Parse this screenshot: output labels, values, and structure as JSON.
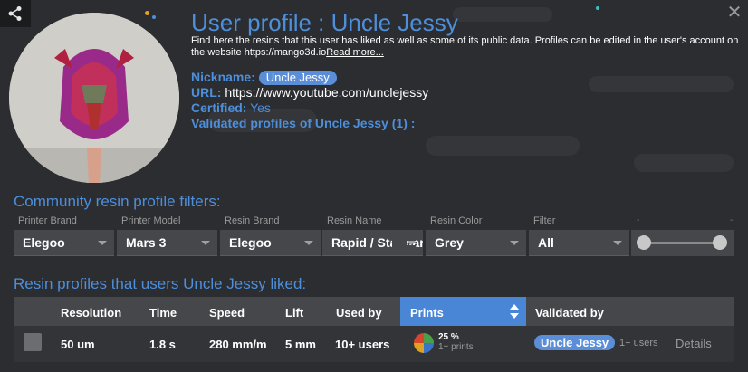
{
  "header": {
    "title": "User profile : Uncle Jessy",
    "description": "Find here the resins that this user has liked as well as some of its public data. Profiles can be edited in the user's account on the website https://mango3d.io",
    "read_more": "Read more...",
    "share_icon": "share-icon",
    "close_icon": "close-icon"
  },
  "profile": {
    "nickname_label": "Nickname:",
    "nickname": "Uncle Jessy",
    "url_label": "URL:",
    "url": "https://www.youtube.com/unclejessy",
    "certified_label": "Certified:",
    "certified": "Yes",
    "validated_profiles": "Validated profiles of Uncle Jessy (1) :"
  },
  "filters": {
    "title": "Community resin profile filters:",
    "items": [
      {
        "label": "Printer Brand",
        "value": "Elegoo"
      },
      {
        "label": "Printer Model",
        "value": "Mars 3"
      },
      {
        "label": "Resin Brand",
        "value": "Elegoo"
      },
      {
        "label": "Resin Name",
        "value": "Rapid / Standard"
      },
      {
        "label": "Resin Color",
        "value": "Grey"
      },
      {
        "label": "Filter",
        "value": "All"
      }
    ],
    "dash": "-"
  },
  "liked": {
    "title": "Resin profiles that users Uncle Jessy liked:",
    "columns": [
      "Resolution",
      "Time",
      "Speed",
      "Lift",
      "Used by",
      "Prints",
      "Validated by"
    ],
    "rows": [
      {
        "resolution": "50 um",
        "time": "1.8 s",
        "speed": "280 mm/m",
        "lift": "5 mm",
        "used_by": "10+ users",
        "prints_pct": "25 %",
        "prints_sub": "1+ prints",
        "validated_by": "Uncle Jessy",
        "validated_note": "1+ users",
        "details": "Details"
      }
    ]
  },
  "colors": {
    "accent": "#4d8fdb",
    "background": "#2b2d31",
    "badge": "#5b8ed8"
  }
}
